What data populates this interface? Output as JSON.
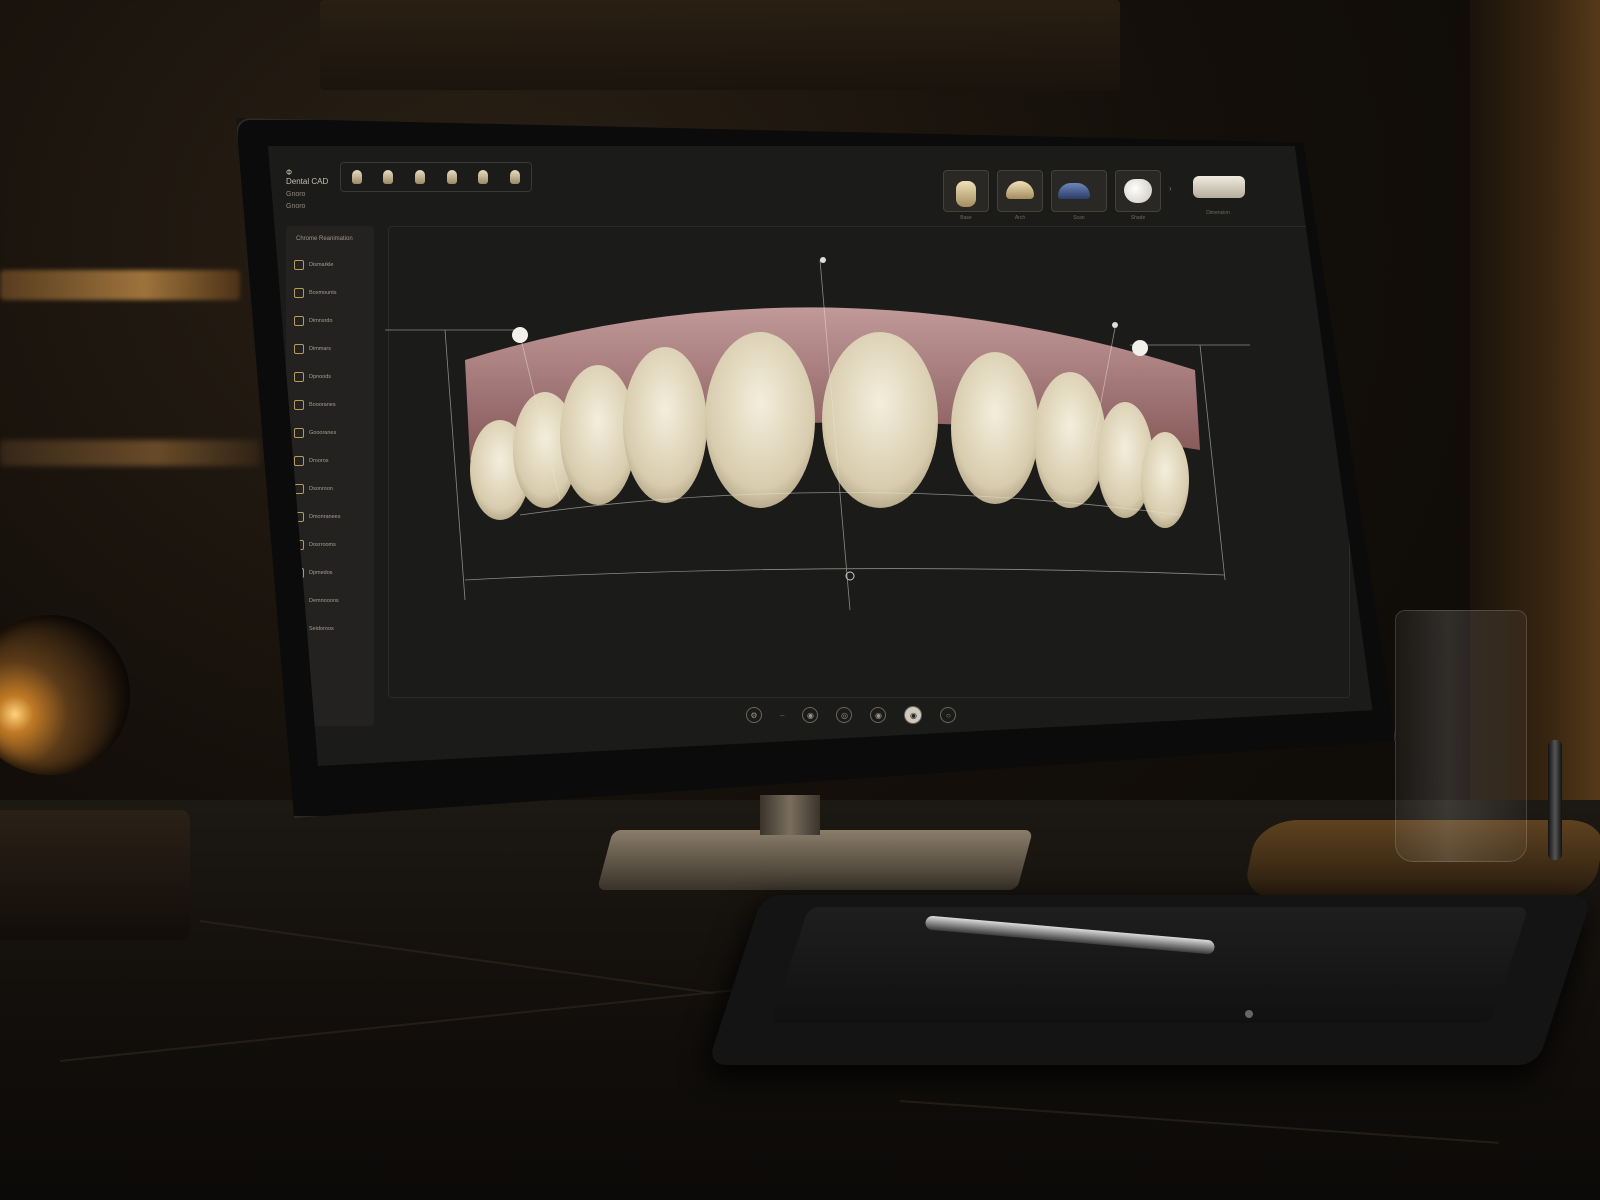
{
  "app": {
    "title_line": "Dental CAD",
    "toolbar_top": "Ф",
    "sub1": "Gnoro",
    "sub2": "Gnoro",
    "tooth_strip_count": 6
  },
  "sidebar": {
    "header": "Chrome Reanimation",
    "items": [
      {
        "label": "Dismarkle",
        "icon": "tooth-icon"
      },
      {
        "label": "Boxmounts",
        "icon": "tooth-icon"
      },
      {
        "label": "Dimnsrdo",
        "icon": "tooth-icon"
      },
      {
        "label": "Dimmars",
        "icon": "tooth-icon"
      },
      {
        "label": "Dpnoods",
        "icon": "tooth-icon"
      },
      {
        "label": "Boooranes",
        "icon": "tooth-icon"
      },
      {
        "label": "Goooranes",
        "icon": "tooth-icon"
      },
      {
        "label": "Drooros",
        "icon": "tooth-icon"
      },
      {
        "label": "Dsonroon",
        "icon": "tooth-icon"
      },
      {
        "label": "Dmonranees",
        "icon": "tooth-icon"
      },
      {
        "label": "Dosrrooms",
        "icon": "tooth-icon"
      },
      {
        "label": "Dpmedos",
        "icon": "tooth-icon"
      },
      {
        "label": "Demnooons",
        "icon": "tooth-icon"
      },
      {
        "label": "Seidoroos",
        "icon": "tooth-icon"
      }
    ]
  },
  "thumbnails": [
    {
      "kind": "crown",
      "caption": "Base"
    },
    {
      "kind": "arch",
      "caption": "Arch"
    },
    {
      "kind": "scan",
      "caption": "Scan"
    },
    {
      "kind": "veneer",
      "caption": "Shade"
    },
    {
      "kind": "model",
      "caption": "Dimension"
    }
  ],
  "bottom_bar": {
    "buttons": [
      "⚙",
      "–",
      "◉",
      "◎",
      "◉",
      "◉",
      "○"
    ],
    "active_index": 5
  },
  "colors": {
    "screen_bg": "#1b1b1a",
    "gum": "#b07878",
    "tooth": "#e6dcc2",
    "guide": "#e8e4da",
    "accent_gold": "#b59a5c"
  }
}
